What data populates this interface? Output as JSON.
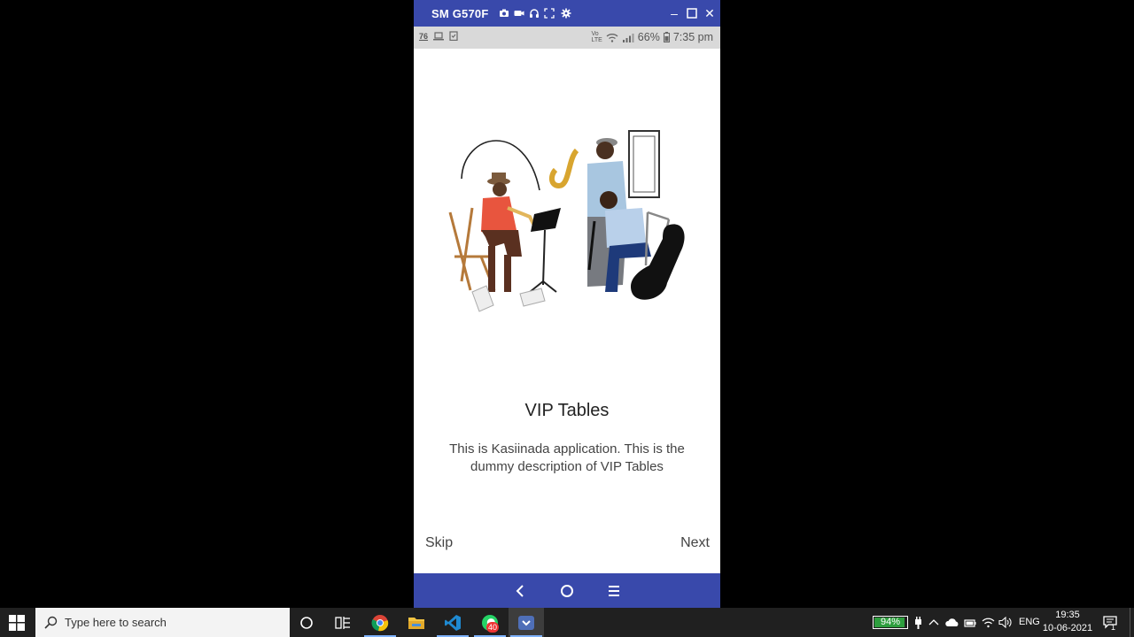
{
  "window": {
    "title": "SM G570F"
  },
  "status_bar": {
    "left_number": "76",
    "battery": "66%",
    "time": "7:35 pm"
  },
  "slide": {
    "title": "VIP Tables",
    "description": "This is Kasiinada application. This is the dummy description of VIP Tables",
    "skip_label": "Skip",
    "next_label": "Next"
  },
  "taskbar": {
    "search_placeholder": "Type here to search",
    "whatsapp_badge": "40",
    "battery_percent": "94%",
    "battery_level": 0.94,
    "language": "ENG",
    "time": "19:35",
    "date": "10-06-2021",
    "notification_count": "1"
  },
  "colors": {
    "titlebar": "#3949ab",
    "navbar": "#3949ab",
    "taskbar": "#202020",
    "battery_green": "#2e9e3e"
  }
}
